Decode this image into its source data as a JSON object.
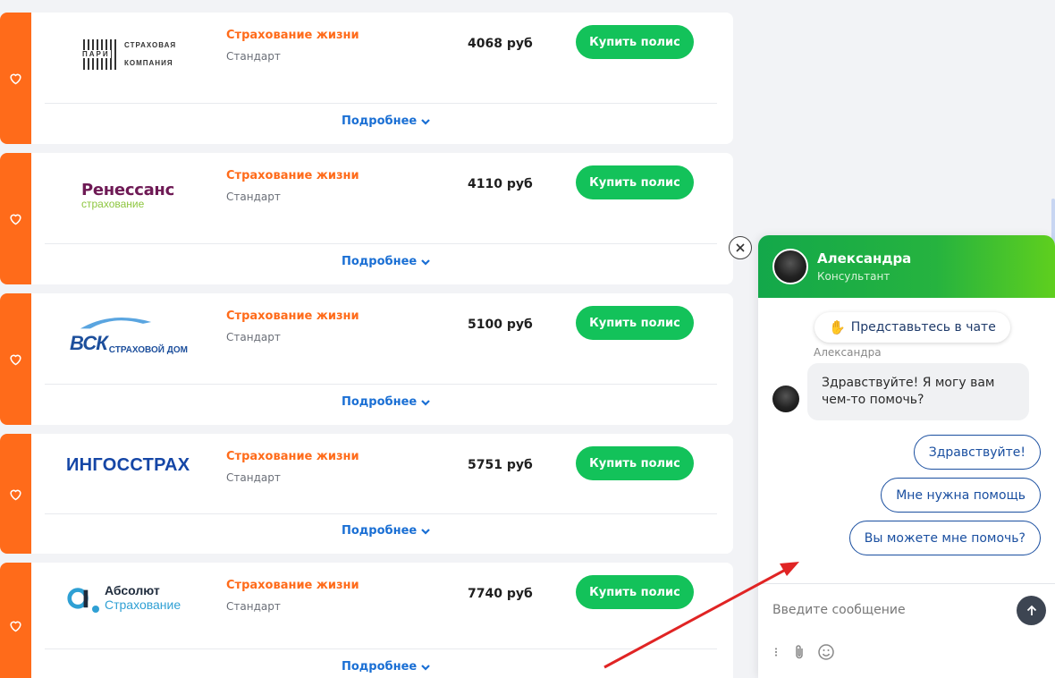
{
  "offers": [
    {
      "insurer": "Пари",
      "logo_lines": [
        "СТРАХОВАЯ",
        "ПАРИ",
        "КОМПАНИЯ"
      ],
      "product": "Страхование жизни",
      "tier": "Стандарт",
      "price": "4068 руб",
      "buy_label": "Купить полис",
      "more_label": "Подробнее"
    },
    {
      "insurer": "Ренессанс",
      "logo_lines": [
        "Ренессанс",
        "страхование"
      ],
      "product": "Страхование жизни",
      "tier": "Стандарт",
      "price": "4110 руб",
      "buy_label": "Купить полис",
      "more_label": "Подробнее"
    },
    {
      "insurer": "ВСК",
      "logo_lines": [
        "ВСК",
        "СТРАХОВОЙ ДОМ"
      ],
      "product": "Страхование жизни",
      "tier": "Стандарт",
      "price": "5100 руб",
      "buy_label": "Купить полис",
      "more_label": "Подробнее"
    },
    {
      "insurer": "Ингосстрах",
      "logo_lines": [
        "ИНГОССТРАХ"
      ],
      "product": "Страхование жизни",
      "tier": "Стандарт",
      "price": "5751 руб",
      "buy_label": "Купить полис",
      "more_label": "Подробнее"
    },
    {
      "insurer": "Абсолют",
      "logo_lines": [
        "Абсолют",
        "Страхование"
      ],
      "product": "Страхование жизни",
      "tier": "Стандарт",
      "price": "7740 руб",
      "buy_label": "Купить полис",
      "more_label": "Подробнее"
    }
  ],
  "chat": {
    "agent_name": "Александра",
    "agent_role": "Консультант",
    "intro_button": "Представьтесь в чате",
    "message_sender": "Александра",
    "message_text": "Здравствуйте! Я могу вам чем-то помочь?",
    "quick_replies": [
      "Здравствуйте!",
      "Мне нужна помощь",
      "Вы можете мне помочь?"
    ],
    "input_placeholder": "Введите сообщение"
  },
  "icons": {
    "favorite": "heart-icon",
    "expand": "chevron-down-icon",
    "close": "close-icon",
    "send": "arrow-up-icon",
    "menu": "more-vertical-icon",
    "attach": "paperclip-icon",
    "emoji": "smile-icon",
    "wave": "waving-hand-icon"
  },
  "colors": {
    "accent_orange": "#ff6b1a",
    "buy_green": "#13c25a",
    "link_blue": "#1a6fd4",
    "chat_header": "#26b33f",
    "annotation_arrow": "#e02424"
  }
}
